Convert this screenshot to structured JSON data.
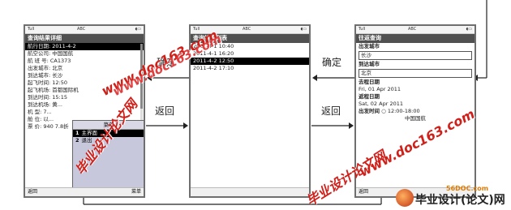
{
  "phone1": {
    "status": {
      "signal": "Tull",
      "mid": "ABC",
      "battery": "◖▭"
    },
    "title": "查询结果详细",
    "rows": [
      "航行日期: 2011-4-2",
      "航空公司: 中国国航",
      "航 班 号: CA1373",
      "出发城市: 北京",
      "到达城市: 长沙",
      "起飞时间: 12:50",
      "起飞机场: 首都国际机",
      "到达时间: 15:15",
      "到达机场: 黄...",
      "机    型: 7...",
      "舱    位: 以...",
      "票    价: 940 7.8折"
    ],
    "softkeys": {
      "left": "返回",
      "right": "菜单"
    },
    "menu": {
      "title": "菜单",
      "items": [
        {
          "num": "1",
          "label": "主界面"
        },
        {
          "num": "2",
          "label": "退出"
        }
      ]
    }
  },
  "phone2": {
    "status": {
      "signal": "Tull",
      "mid": "ABC",
      "battery": "◖▭"
    },
    "title": "查询结果列表",
    "rows": [
      "2011-4-1 10:40",
      "2011-4-1 16:20",
      "2011-4-2 12:50",
      "2011-4-2 17:10"
    ],
    "softkeys": {
      "left": "",
      "right": ""
    }
  },
  "phone3": {
    "status": {
      "signal": "Tull",
      "mid": "ABC",
      "battery": "◖▭"
    },
    "title": "往返查询",
    "depart_label": "出发城市",
    "depart_value": "长沙",
    "arrive_label": "到达城市",
    "arrive_value": "北京",
    "go_label": "去程日期",
    "go_value": "Fri, 01 Apr 2011",
    "return_label": "返程日期",
    "return_value": "Sat, 02 Apr 2011",
    "time_label": "出发时间",
    "time_value": "○ 12:00-18:00",
    "airline_value": "中国国航",
    "softkeys": {
      "left": "返回",
      "right": ""
    }
  },
  "labels": {
    "confirm1": "确定",
    "confirm2": "确定",
    "back1": "返回",
    "back2": "返回"
  },
  "watermarks": {
    "wm1": "毕业设计论文网",
    "wm2": "www.doc163.com",
    "wm3": "www.doc163.com",
    "wm4": "毕业设计论文网",
    "wm5": "www.doc163.com"
  },
  "logo": {
    "site": "56DOC.com",
    "text": "毕业设计(论文)网"
  }
}
